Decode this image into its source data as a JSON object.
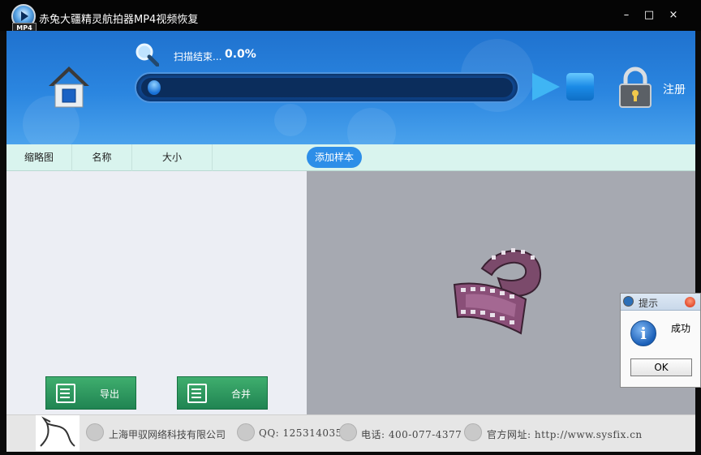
{
  "window": {
    "title": "赤兔大疆精灵航拍器MP4视频恢复",
    "icon_badge": "MP4",
    "minimize": "–",
    "maximize": "□",
    "close": "×"
  },
  "header": {
    "scan_label": "扫描结束...",
    "scan_percent": "0.0%",
    "progress": 0.0,
    "register_label": "注册",
    "colors": {
      "accent": "#2b86e0",
      "progress_track": "#0b2d5c"
    }
  },
  "list": {
    "columns": [
      "缩略图",
      "名称",
      "大小"
    ],
    "add_sample_label": "添加样本"
  },
  "actions": {
    "export_label": "导出",
    "merge_label": "合并"
  },
  "footer": {
    "company": "上海甲驭网络科技有限公司",
    "qq": "QQ: 1253140355",
    "phone": "电话: 400-077-4377",
    "website": "官方网址: http://www.sysfix.cn"
  },
  "dialog": {
    "title": "提示",
    "message": "成功",
    "ok_label": "OK",
    "info_glyph": "i"
  }
}
